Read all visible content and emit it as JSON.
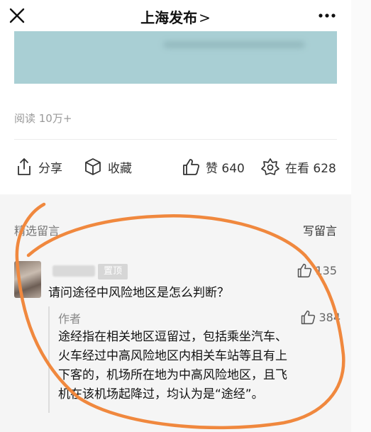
{
  "header": {
    "title": "上海发布",
    "chevron": ">",
    "close_icon": "close-icon",
    "more_icon": "more-dots-icon"
  },
  "article": {
    "read_count": "阅读 10万+",
    "actions": {
      "share": "分享",
      "favorite": "收藏",
      "like": "赞 640",
      "watching": "在看 628"
    }
  },
  "comments": {
    "section_title": "精选留言",
    "write_label": "写留言",
    "items": [
      {
        "pin_label": "置顶",
        "likes": "135",
        "text": "请问途径中风险地区是怎么判断？",
        "reply": {
          "author": "作者",
          "likes": "384",
          "lines": [
            "途经指在相关地区逗留过，包括乘坐汽车、",
            "火车经过中高风险地区内相关车站等且有上",
            "下客的，机场所在地为中高风险地区，且飞",
            "机在该机场起降过，均认为是“途经”。"
          ]
        }
      }
    ]
  },
  "colors": {
    "banner": "#a9cfd4",
    "annotation": "#f0883e"
  }
}
